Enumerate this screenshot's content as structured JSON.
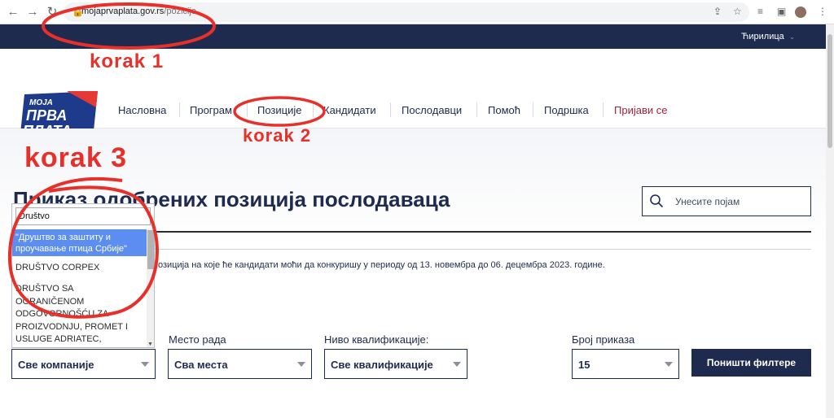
{
  "browser": {
    "url_domain": "mojaprvaplata.gov.rs",
    "url_path": "/pozicije",
    "back_icon": "arrow-left-icon",
    "forward_icon": "arrow-right-icon",
    "reload_icon": "reload-icon"
  },
  "topbar": {
    "language": "Ћирилица"
  },
  "logo": {
    "line1": "МОЈА",
    "line2": "ПРВА",
    "line3": "ПЛАТА"
  },
  "nav": {
    "items": [
      "Насловна",
      "Програм",
      "Позиције",
      "Кандидати",
      "Послодавци",
      "Помоћ",
      "Подршка"
    ],
    "login": "Пријави се"
  },
  "page": {
    "title": "Приказ одобрених позиција послодаваца",
    "description": "позиција на које ће кандидати моћи да конкуришу у периоду од 13. новембра до 06. децембра 2023. године."
  },
  "search": {
    "placeholder": "Унесите појам"
  },
  "filters": {
    "location_label": "Место рада",
    "qualification_label": "Ниво квалификације:",
    "count_label": "Број приказа",
    "company_value": "Све компаније",
    "location_value": "Сва места",
    "qualification_value": "Све квалификације",
    "count_value": "15",
    "reset_button": "Поништи филтере"
  },
  "dropdown": {
    "typed": "Društvo",
    "options": [
      "\"Друштво за заштиту и проучавање птица Србије\"",
      "DRUŠTVO CORPEX",
      "DRUŠTVO SA OGRANIČENOM ODGOVORNOŠĆU ZA PROIZVODNJU, PROMET I USLUGE ADRIATEC,"
    ]
  },
  "annotations": {
    "step1": "korak 1",
    "step2": "korak 2",
    "step3": "korak 3"
  },
  "colors": {
    "navy": "#1e2b4f",
    "annotation_red": "#e8302a",
    "dropdown_highlight": "#5b8ef0",
    "login_red": "#a0213a"
  }
}
